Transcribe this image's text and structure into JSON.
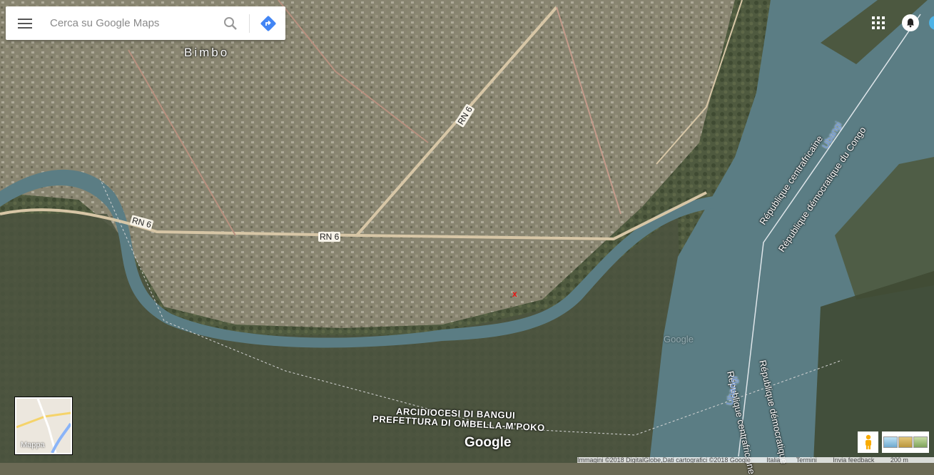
{
  "search": {
    "placeholder": "Cerca su Google Maps"
  },
  "labels": {
    "town": "Bimbo",
    "road_a": "RN 6",
    "road_b": "RN 6",
    "road_c": "RN 6",
    "border_1": "République centrafricaine",
    "border_2": "République démocratique du Congo",
    "border_3": "République centrafricaine",
    "border_4": "République démocratique",
    "river_1": "Ubangi",
    "river_2": "Ubangi",
    "admin_1": "ARCIDIOCESI DI BANGUI",
    "admin_2": "PREFETTURA DI OMBELLA-M'POKO",
    "watermark": "Google",
    "marker": "x"
  },
  "minimap": {
    "label": "Mappa"
  },
  "logo": "Google",
  "footer": {
    "imagery": "Immagini ©2018 DigitalGlobe,Dati cartografici ©2018 Google",
    "region": "Italia",
    "terms": "Termini",
    "feedback": "Invia feedback",
    "scale": "200 m"
  },
  "colors": {
    "river": "#5a7f86",
    "land": "#6b6a55",
    "accent_blue": "#4285f4"
  },
  "icons": [
    "menu-icon",
    "search-icon",
    "directions-icon",
    "apps-icon",
    "notifications-icon",
    "pegman-icon"
  ]
}
